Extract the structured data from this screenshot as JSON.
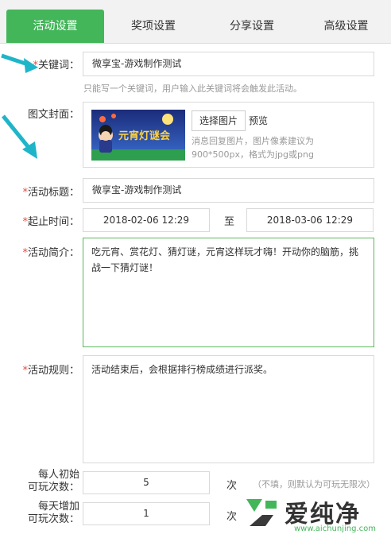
{
  "tabs": [
    "活动设置",
    "奖项设置",
    "分享设置",
    "高级设置"
  ],
  "form": {
    "keyword": {
      "label": "关键词：",
      "value": "微享宝-游戏制作测试",
      "hint": "只能写一个关键词，用户输入此关键词将会触发此活动。"
    },
    "cover": {
      "label": "图文封面：",
      "select_button": "选择图片",
      "preview_link": "预览",
      "hint_line1": "消息回复图片，图片像素建议为",
      "hint_line2": "900*500px，格式为jpg或png",
      "image_title": "元宵灯谜会"
    },
    "title": {
      "label": "活动标题：",
      "value": "微享宝-游戏制作测试"
    },
    "time": {
      "label": "起止时间：",
      "start": "2018-02-06 12:29",
      "sep": "至",
      "end": "2018-03-06 12:29"
    },
    "intro": {
      "label": "活动简介：",
      "value": "吃元宵、赏花灯、猜灯谜，元宵这样玩才嗨！开动你的脑筋，挑战一下猜灯谜！"
    },
    "rules": {
      "label": "活动规则：",
      "value": "活动结束后，会根据排行榜成绩进行派奖。"
    },
    "init_plays": {
      "label_line1": "每人初始",
      "label_line2": "可玩次数：",
      "value": "5",
      "unit": "次",
      "hint": "（不填，则默认为可玩无限次）"
    },
    "daily_plays": {
      "label_line1": "每天增加",
      "label_line2": "可玩次数：",
      "value": "1",
      "unit": "次"
    }
  },
  "watermark": {
    "name": "爱纯净",
    "url": "www.aichunjing.com"
  },
  "colors": {
    "accent": "#43b65a",
    "required": "#e74c3c",
    "arrow": "#1fb5c9"
  }
}
